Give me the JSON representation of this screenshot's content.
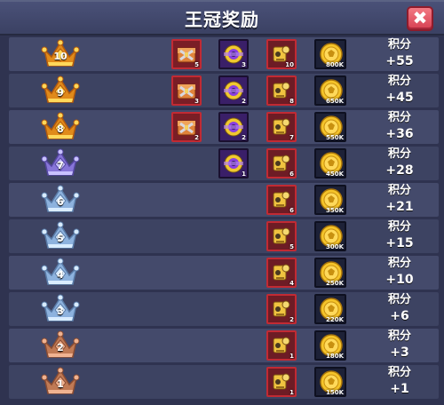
{
  "header": {
    "title": "王冠奖励",
    "close_icon": "close-icon"
  },
  "colors": {
    "gold": "#f5b82e",
    "silver": "#a8c3e8",
    "purple": "#9d8fe0",
    "bronze": "#c98660"
  },
  "rewards": [
    {
      "tier": "10",
      "crown": "gold",
      "chest": "5",
      "ring": "3",
      "scroll": "10",
      "coin": "800K",
      "score_label": "积分",
      "score": "+55"
    },
    {
      "tier": "9",
      "crown": "gold",
      "chest": "3",
      "ring": "2",
      "scroll": "8",
      "coin": "650K",
      "score_label": "积分",
      "score": "+45"
    },
    {
      "tier": "8",
      "crown": "gold",
      "chest": "2",
      "ring": "2",
      "scroll": "7",
      "coin": "550K",
      "score_label": "积分",
      "score": "+36"
    },
    {
      "tier": "7",
      "crown": "purple",
      "chest": null,
      "ring": "1",
      "scroll": "6",
      "coin": "450K",
      "score_label": "积分",
      "score": "+28"
    },
    {
      "tier": "6",
      "crown": "silver",
      "chest": null,
      "ring": null,
      "scroll": "6",
      "coin": "350K",
      "score_label": "积分",
      "score": "+21"
    },
    {
      "tier": "5",
      "crown": "silver",
      "chest": null,
      "ring": null,
      "scroll": "5",
      "coin": "300K",
      "score_label": "积分",
      "score": "+15"
    },
    {
      "tier": "4",
      "crown": "silver",
      "chest": null,
      "ring": null,
      "scroll": "4",
      "coin": "250K",
      "score_label": "积分",
      "score": "+10"
    },
    {
      "tier": "3",
      "crown": "silver",
      "chest": null,
      "ring": null,
      "scroll": "2",
      "coin": "220K",
      "score_label": "积分",
      "score": "+6"
    },
    {
      "tier": "2",
      "crown": "bronze",
      "chest": null,
      "ring": null,
      "scroll": "1",
      "coin": "180K",
      "score_label": "积分",
      "score": "+3"
    },
    {
      "tier": "1",
      "crown": "bronze",
      "chest": null,
      "ring": null,
      "scroll": "1",
      "coin": "150K",
      "score_label": "积分",
      "score": "+1"
    }
  ]
}
